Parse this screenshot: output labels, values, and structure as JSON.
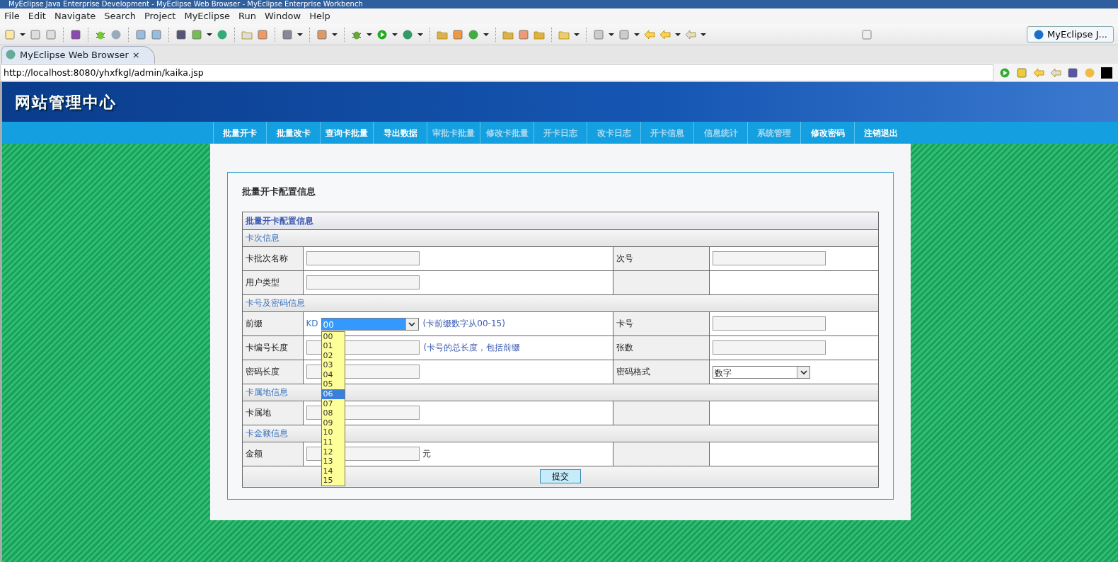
{
  "window": {
    "title": "MyEclipse Java Enterprise Development - MyEclipse Web Browser - MyEclipse Enterprise Workbench"
  },
  "menu": [
    "File",
    "Edit",
    "Navigate",
    "Search",
    "Project",
    "MyEclipse",
    "Run",
    "Window",
    "Help"
  ],
  "perspective": {
    "label": "MyEclipse J..."
  },
  "editor_tab": {
    "label": "MyEclipse Web Browser",
    "close": "×"
  },
  "browser": {
    "url": "http://localhost:8080/yhxfkgl/admin/kaika.jsp"
  },
  "site": {
    "title": "网站管理中心",
    "nav": [
      {
        "label": "批量开卡",
        "dimmed": false
      },
      {
        "label": "批量改卡",
        "dimmed": false
      },
      {
        "label": "查询卡批量",
        "dimmed": false
      },
      {
        "label": "导出数据",
        "dimmed": false
      },
      {
        "label": "审批卡批量",
        "dimmed": true
      },
      {
        "label": "修改卡批量",
        "dimmed": true
      },
      {
        "label": "开卡日志",
        "dimmed": true
      },
      {
        "label": "改卡日志",
        "dimmed": true
      },
      {
        "label": "开卡信息",
        "dimmed": true
      },
      {
        "label": "信息统计",
        "dimmed": true
      },
      {
        "label": "系统管理",
        "dimmed": true
      },
      {
        "label": "修改密码",
        "dimmed": false
      },
      {
        "label": "注销退出",
        "dimmed": false
      }
    ]
  },
  "form": {
    "heading": "批量开卡配置信息",
    "table_title": "批量开卡配置信息",
    "sections": [
      {
        "title": "卡次信息",
        "rows": [
          {
            "left": {
              "label": "卡批次名称",
              "kind": "input"
            },
            "right": {
              "label": "次号",
              "kind": "input"
            }
          },
          {
            "left": {
              "label": "用户类型",
              "kind": "input"
            },
            "right": {
              "kind": "none"
            }
          }
        ]
      },
      {
        "title": "卡号及密码信息",
        "rows": [
          {
            "left": {
              "label": "前缀",
              "kind": "select",
              "prefix": "KD",
              "value": "00",
              "hint": "(卡前缀数字从00-15)",
              "open": true
            },
            "right": {
              "label": "卡号",
              "kind": "input"
            }
          },
          {
            "left": {
              "label": "卡编号长度",
              "kind": "input",
              "hint": "(卡号的总长度，包括前缀"
            },
            "right": {
              "label": "张数",
              "kind": "input"
            }
          },
          {
            "left": {
              "label": "密码长度",
              "kind": "input"
            },
            "right": {
              "label": "密码格式",
              "kind": "select",
              "value": "数字"
            }
          }
        ]
      },
      {
        "title": "卡属地信息",
        "rows": [
          {
            "left": {
              "label": "卡属地",
              "kind": "input"
            },
            "right": {
              "kind": "none"
            }
          }
        ]
      },
      {
        "title": "卡金额信息",
        "rows": [
          {
            "left": {
              "label": "金额",
              "kind": "input",
              "suffix": "元"
            },
            "right": {
              "kind": "none"
            }
          }
        ]
      }
    ],
    "dropdown": [
      {
        "label": "00",
        "selected": false
      },
      {
        "label": "01",
        "selected": false
      },
      {
        "label": "02",
        "selected": false
      },
      {
        "label": "03",
        "selected": false
      },
      {
        "label": "04",
        "selected": false
      },
      {
        "label": "05",
        "selected": false
      },
      {
        "label": "06",
        "selected": true
      },
      {
        "label": "07",
        "selected": false
      },
      {
        "label": "08",
        "selected": false
      },
      {
        "label": "09",
        "selected": false
      },
      {
        "label": "10",
        "selected": false
      },
      {
        "label": "11",
        "selected": false
      },
      {
        "label": "12",
        "selected": false
      },
      {
        "label": "13",
        "selected": false
      },
      {
        "label": "14",
        "selected": false
      },
      {
        "label": "15",
        "selected": false
      }
    ],
    "submit": "提交"
  }
}
